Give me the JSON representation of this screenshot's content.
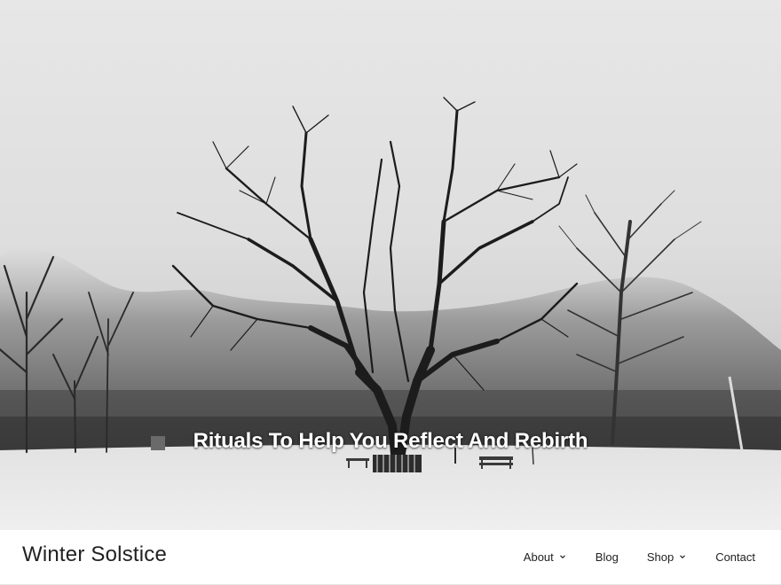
{
  "hero": {
    "title": "Rituals To Help You Reflect And Rebirth"
  },
  "site": {
    "title": "Winter Solstice"
  },
  "nav": {
    "items": [
      {
        "label": "About",
        "has_submenu": true
      },
      {
        "label": "Blog",
        "has_submenu": false
      },
      {
        "label": "Shop",
        "has_submenu": true
      },
      {
        "label": "Contact",
        "has_submenu": false
      }
    ]
  },
  "colors": {
    "text": "#222222",
    "hero_title": "#ffffff",
    "bar_background": "#ffffff"
  },
  "icons": {
    "submenu": "chevron-down-icon"
  }
}
